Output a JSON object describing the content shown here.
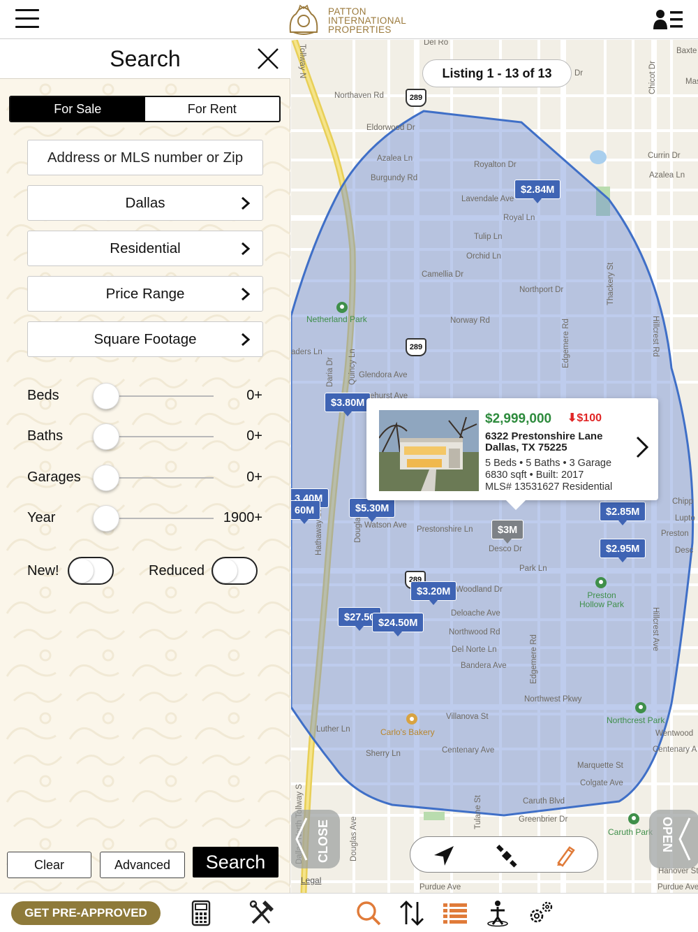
{
  "header": {
    "menu_icon": "hamburger-icon",
    "logo_lines": [
      "PATTON",
      "INTERNATIONAL",
      "PROPERTIES"
    ],
    "user_icon": "user-list-icon"
  },
  "search_panel": {
    "title": "Search",
    "close_icon": "close-icon",
    "tabs": [
      {
        "label": "For Sale",
        "active": true
      },
      {
        "label": "For Rent",
        "active": false
      }
    ],
    "address_placeholder": "Address or MLS number or Zip",
    "fields": [
      {
        "label": "Dallas"
      },
      {
        "label": "Residential"
      },
      {
        "label": "Price Range"
      },
      {
        "label": "Square Footage"
      }
    ],
    "sliders": [
      {
        "label": "Beds",
        "value": "0+"
      },
      {
        "label": "Baths",
        "value": "0+"
      },
      {
        "label": "Garages",
        "value": "0+"
      },
      {
        "label": "Year",
        "value": "1900+"
      }
    ],
    "toggles": [
      {
        "label": "New!",
        "on": false
      },
      {
        "label": "Reduced",
        "on": false
      }
    ],
    "buttons": {
      "clear": "Clear",
      "advanced": "Advanced",
      "search": "Search"
    }
  },
  "map": {
    "listing_count": "Listing 1 - 13 of 13",
    "streets": [
      "Tollway N",
      "Del Ro",
      "Baxte",
      "Northaven Rd",
      "Chicot Dr",
      "Mas",
      "Eldorwood Dr",
      "Azalea Ln",
      "Royalton Dr",
      "Burgundy Rd",
      "Currin Dr",
      "Azalea Ln",
      "Lavendale Ave",
      "Royal Ln",
      "Tulip Ln",
      "Orchid Ln",
      "Camellia Dr",
      "Northport Dr",
      "Thackery St",
      "Norway Rd",
      "Edgemere Rd",
      "Hillcrest Rd",
      "Daria Dr",
      "Quincy Ln",
      "Glendora Ave",
      "aders Ln",
      "ehurst Ave",
      "Hathaway St",
      "Douglas Ave",
      "Watson Ave",
      "Prestonshire Ln",
      "Desco Dr",
      "Park Ln",
      "Woodland Dr",
      "Deloache Ave",
      "Northwood Rd",
      "Del Norte Ln",
      "Bandera Ave",
      "Hillcrest Ave",
      "Edgemere Rd",
      "Northwest Pkwy",
      "Villanova St",
      "Luther Ln",
      "Sherry Ln",
      "Centenary Ave",
      "Marquette St",
      "Colgate Ave",
      "Caruth Blvd",
      "Greenbrier Dr",
      "Dallas North Tollway S",
      "Douglas Ave",
      "Tulane St",
      "Wentwood",
      "Centenary A",
      "Hanover St",
      "Purdue Ave",
      "Purdue Ave",
      "Chipp",
      "Lupto",
      "Preston",
      "Desc",
      "Dr"
    ],
    "parks": [
      "Netherland Park",
      "Preston Hollow Park",
      "Northcrest Park",
      "Caruth Park"
    ],
    "poi": "Carlo's Bakery",
    "highway_shield": "289",
    "pins": [
      {
        "price": "$2.84M",
        "selected": false
      },
      {
        "price": "$3.80M",
        "selected": false
      },
      {
        "price": "3.40M",
        "selected": false
      },
      {
        "price": "60M",
        "selected": false
      },
      {
        "price": "$5.30M",
        "selected": false
      },
      {
        "price": "$3M",
        "selected": true
      },
      {
        "price": "$2.85M",
        "selected": false
      },
      {
        "price": "$2.95M",
        "selected": false
      },
      {
        "price": "$3.20M",
        "selected": false
      },
      {
        "price": "$27.50",
        "selected": false
      },
      {
        "price": "$24.50M",
        "selected": false
      }
    ],
    "popup": {
      "price": "$2,999,000",
      "price_drop": "$100",
      "address_line1": "6322 Prestonshire Lane",
      "address_line2": "Dallas, TX 75225",
      "details1": "5 Beds • 5 Baths • 3 Garage",
      "details2": "6830 sqft • Built: 2017",
      "details3": "MLS# 13531627   Residential"
    },
    "close_tab": "CLOSE",
    "open_tab": "OPEN",
    "legal": "Legal",
    "tools": [
      "location-arrow-icon",
      "satellite-icon",
      "draw-pencil-icon"
    ]
  },
  "bottom_bar": {
    "preapproved": "GET PRE-APPROVED",
    "left_icons": [
      "calculator-icon",
      "tools-icon"
    ],
    "right_icons": [
      "search-icon",
      "sort-icon",
      "list-icon",
      "person-icon",
      "settings-icon"
    ]
  },
  "colors": {
    "accent_gold": "#8e7a3a",
    "pin_blue": "#3f64b4",
    "price_green": "#2e8b3d",
    "price_drop_red": "#e02525",
    "search_area_fill": "#6f8fd6"
  }
}
